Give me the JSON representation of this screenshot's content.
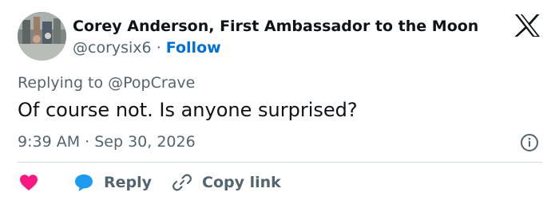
{
  "author": {
    "name": "Corey Anderson, First Ambassador to the Moon",
    "handle": "@corysix6",
    "separator": "·",
    "follow_label": "Follow"
  },
  "tweet": {
    "replying_to": "Replying to @PopCrave",
    "text": "Of course not. Is anyone surprised?",
    "timestamp": "9:39 AM · Sep 30, 2026"
  },
  "actions": {
    "reply_label": "Reply",
    "copy_link_label": "Copy link"
  },
  "icons": {
    "brand": "x-logo-icon",
    "info": "info-icon",
    "like": "heart-icon",
    "reply": "reply-bubble-icon",
    "copy": "link-icon"
  },
  "colors": {
    "text": "#0f1419",
    "secondary": "#536471",
    "link": "#006fd6",
    "like": "#f91880",
    "reply": "#1d9bf0",
    "divider": "#cfd9de"
  }
}
